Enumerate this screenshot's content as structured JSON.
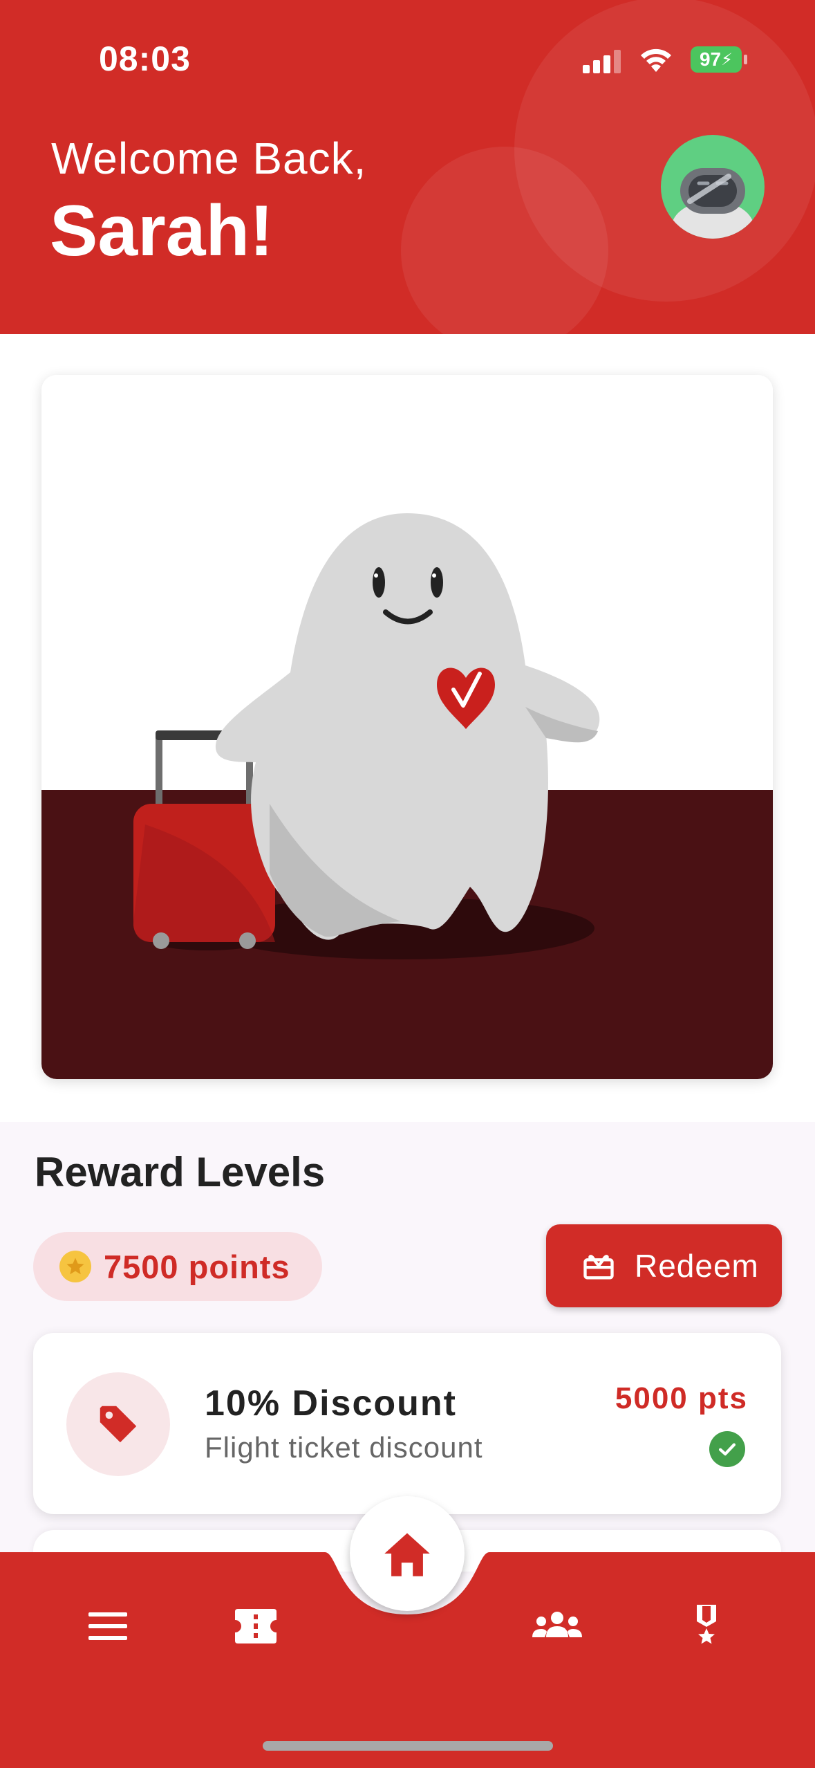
{
  "status_bar": {
    "time": "08:03",
    "battery": "97",
    "icons": [
      "cellular-signal-icon",
      "wifi-icon",
      "battery-charging-icon"
    ]
  },
  "header": {
    "welcome": "Welcome Back,",
    "name": "Sarah!",
    "avatar_icon": "robot-avatar-icon"
  },
  "hero": {
    "illustration": "ghost-mascot-with-suitcase-illustration"
  },
  "rewards": {
    "title": "Reward Levels",
    "points": "7500 points",
    "redeem_label": "Redeem",
    "items": [
      {
        "title": "10% Discount",
        "subtitle": "Flight ticket discount",
        "points": "5000 pts",
        "unlocked": true,
        "icon": "tag-icon"
      }
    ]
  },
  "bottom_nav": {
    "items": [
      "menu-icon",
      "ticket-icon",
      "home-icon",
      "group-icon",
      "medal-icon"
    ],
    "active": "home-icon"
  },
  "colors": {
    "brand_red": "#d12c27",
    "dark_floor": "#4a1114",
    "star_yellow": "#f6c440",
    "success_green": "#43a04a"
  }
}
